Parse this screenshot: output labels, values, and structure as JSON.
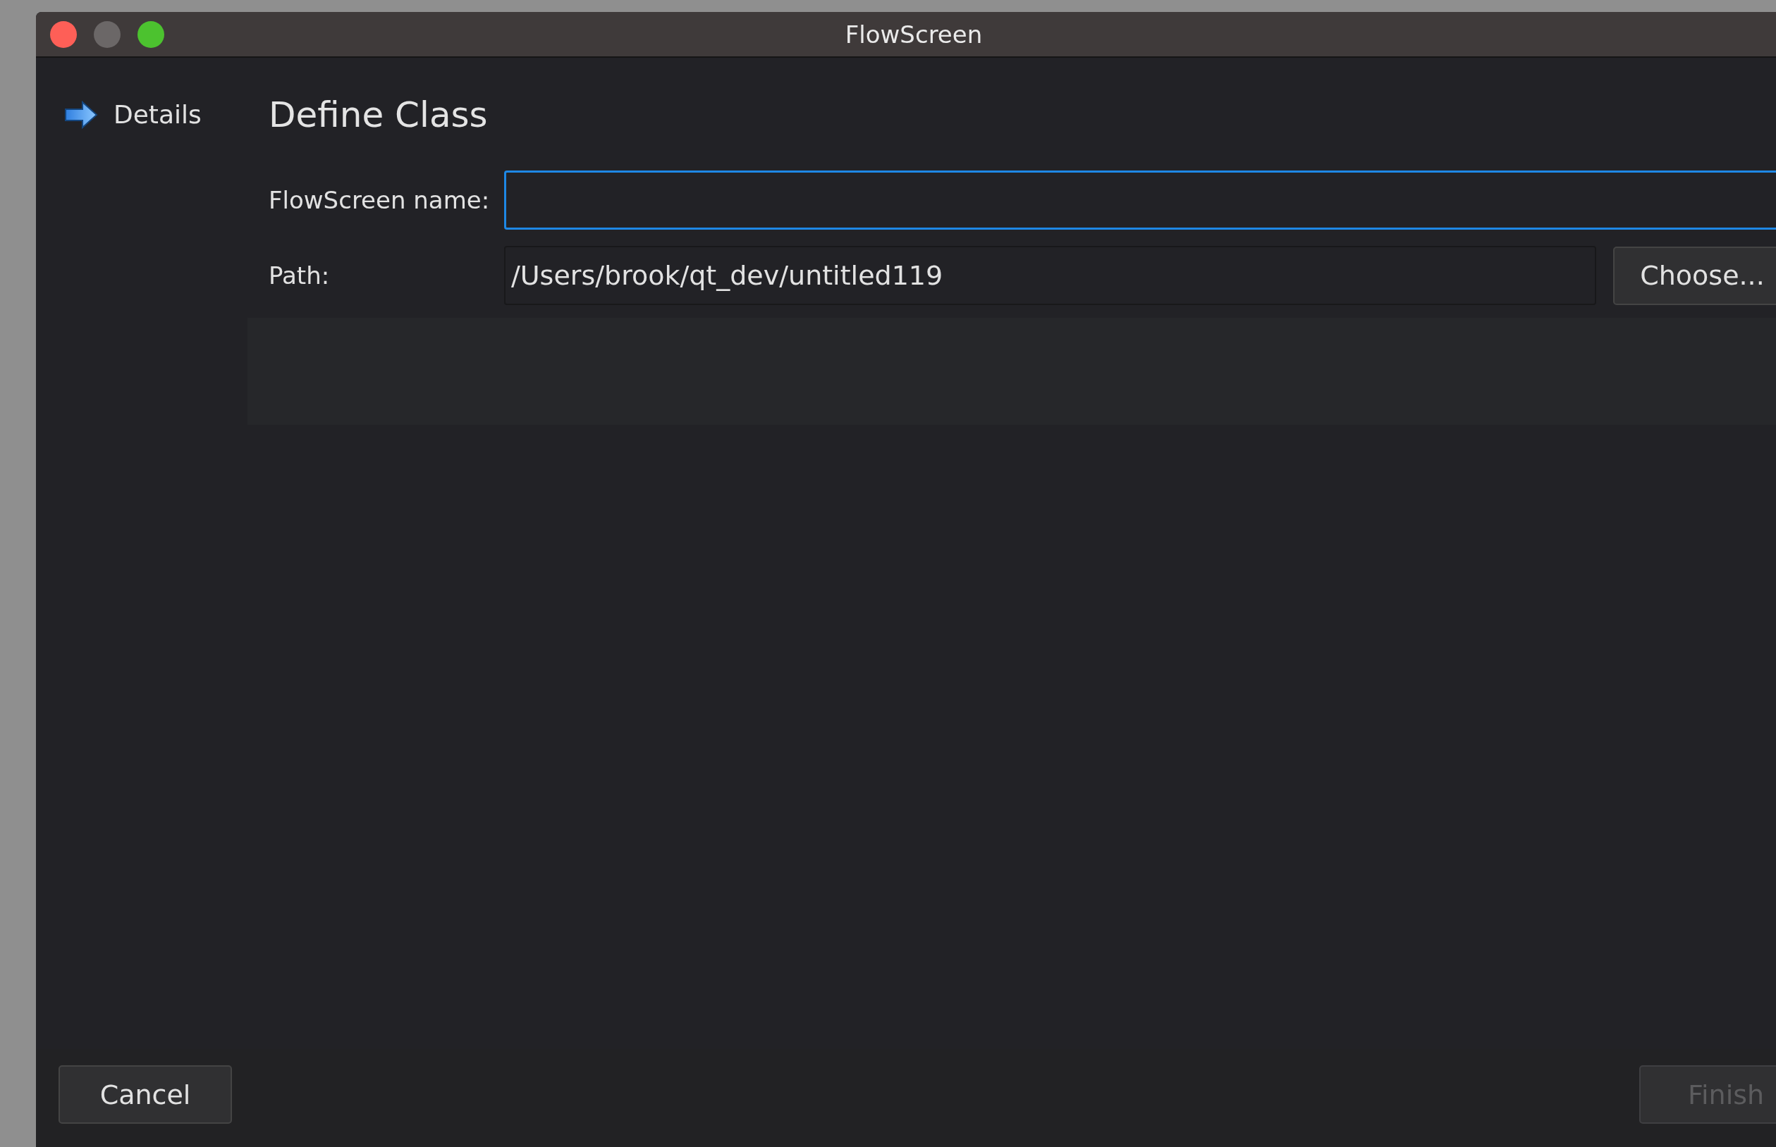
{
  "window": {
    "title": "FlowScreen"
  },
  "window_controls": [
    {
      "color": "#fe5f57"
    },
    {
      "color": "#6b6767"
    },
    {
      "color": "#4cc22f"
    }
  ],
  "sidebar": {
    "items": [
      {
        "label": "Details",
        "selected": true
      }
    ]
  },
  "page": {
    "title": "Define Class"
  },
  "form": {
    "fields": [
      {
        "label": "FlowScreen name:",
        "focused": true
      },
      {
        "label": "Path:",
        "value": "/Users/brook/qt_dev/untitled119",
        "focused": false,
        "button": "Choose..."
      }
    ]
  },
  "buttons": [
    {
      "label": "Cancel",
      "disabled": false
    },
    {
      "label": "Finish",
      "disabled": true
    }
  ]
}
